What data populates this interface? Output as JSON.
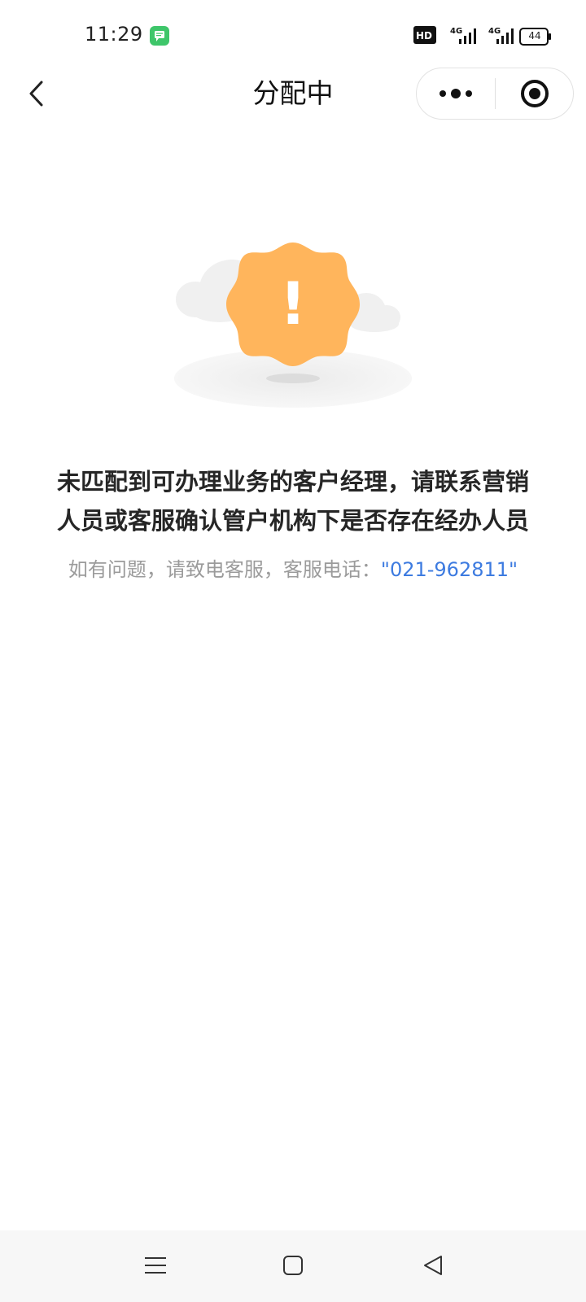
{
  "status_bar": {
    "time": "11:29",
    "network_badge": "HD",
    "signal_1": "4G",
    "signal_2": "4G",
    "battery": "44",
    "icons": [
      "chat-app-icon",
      "hd-icon",
      "signal-4g-icon",
      "signal-4g-icon",
      "battery-icon"
    ]
  },
  "nav": {
    "title": "分配中",
    "back_icon": "chevron-left-icon",
    "more_icon": "more-dots-icon",
    "close_icon": "record-target-icon"
  },
  "content": {
    "illustration_icon": "warning-badge-icon",
    "illustration_mark": "!",
    "message_line1": "未匹配到可办理业务的客户经理，请联系营销",
    "message_line2": "人员或客服确认管户机构下是否存在经办人员",
    "hint_prefix": "如有问题，请致电客服，客服电话：",
    "phone": "\"021-962811\""
  },
  "colors": {
    "badge": "#ffb55c",
    "link": "#3d7be0",
    "hint": "#9b9b9b"
  },
  "system_nav": {
    "icons": [
      "menu-icon",
      "home-square-icon",
      "back-triangle-icon"
    ]
  }
}
